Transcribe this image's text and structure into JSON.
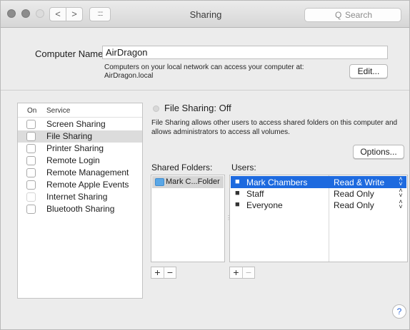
{
  "titlebar": {
    "title": "Sharing",
    "back_icon": "<",
    "forward_icon": ">",
    "grid_icon": "::::",
    "search_placeholder": "Search",
    "search_icon": "Q"
  },
  "computer": {
    "name_label": "Computer Name:",
    "name_value": "AirDragon",
    "note": "Computers on your local network can access your computer at: AirDragon.local",
    "edit_label": "Edit..."
  },
  "services": {
    "header_on": "On",
    "header_service": "Service",
    "items": [
      {
        "label": "Screen Sharing",
        "checked": false
      },
      {
        "label": "File Sharing",
        "checked": false,
        "selected": true
      },
      {
        "label": "Printer Sharing",
        "checked": false
      },
      {
        "label": "Remote Login",
        "checked": false
      },
      {
        "label": "Remote Management",
        "checked": false
      },
      {
        "label": "Remote Apple Events",
        "checked": false
      },
      {
        "label": "Internet Sharing",
        "checked": false,
        "disabled": true
      },
      {
        "label": "Bluetooth Sharing",
        "checked": false
      }
    ]
  },
  "file_sharing": {
    "status": "File Sharing: Off",
    "description": "File Sharing allows other users to access shared folders on this computer and allows administrators to access all volumes.",
    "options_label": "Options...",
    "shared_folders_label": "Shared Folders:",
    "users_label": "Users:",
    "folders": [
      {
        "name": "Mark C...Folder"
      }
    ],
    "users": [
      {
        "name": "Mark Chambers",
        "permission": "Read & Write",
        "icon": "user-icon",
        "selected": true
      },
      {
        "name": "Staff",
        "permission": "Read Only",
        "icon": "group-icon"
      },
      {
        "name": "Everyone",
        "permission": "Read Only",
        "icon": "everyone-icon"
      }
    ],
    "plus": "+",
    "minus": "−"
  },
  "help": {
    "label": "?"
  },
  "colors": {
    "selection": "#1d6adf",
    "folder": "#5aa7e6",
    "help_text": "#2a66d8"
  }
}
